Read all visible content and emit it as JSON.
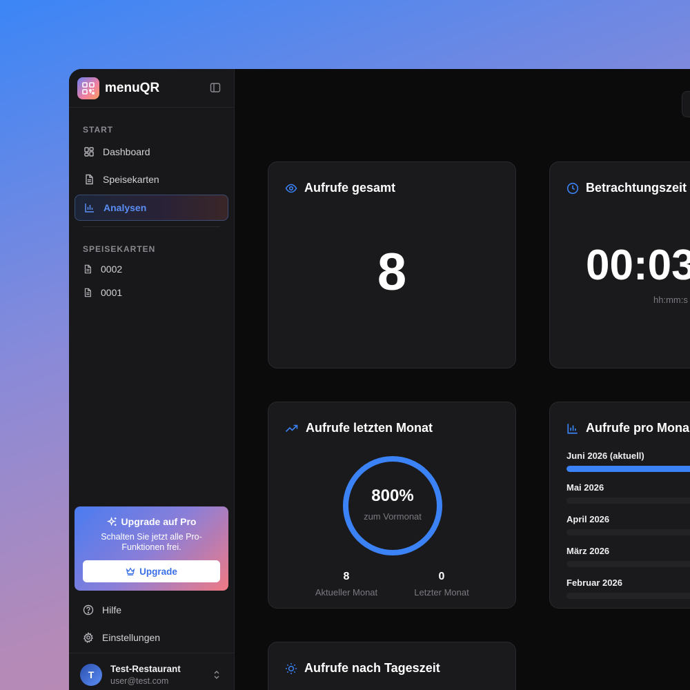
{
  "app": {
    "name": "menuQR"
  },
  "sidebar": {
    "section_start": "START",
    "nav": [
      {
        "label": "Dashboard",
        "icon": "dashboard-icon",
        "active": false
      },
      {
        "label": "Speisekarten",
        "icon": "document-icon",
        "active": false
      },
      {
        "label": "Analysen",
        "icon": "bar-chart-icon",
        "active": true
      }
    ],
    "section_menus": "SPEISEKARTEN",
    "menus": [
      {
        "label": "0002"
      },
      {
        "label": "0001"
      }
    ],
    "upgrade": {
      "title": "Upgrade auf Pro",
      "text": "Schalten Sie jetzt alle Pro-Funktionen frei.",
      "button": "Upgrade"
    },
    "footer_nav": [
      {
        "label": "Hilfe",
        "icon": "help-icon"
      },
      {
        "label": "Einstellungen",
        "icon": "gear-icon"
      }
    ],
    "user": {
      "initial": "T",
      "name": "Test-Restaurant",
      "email": "user@test.com"
    }
  },
  "cards": {
    "total_views": {
      "title": "Aufrufe gesamt",
      "value": "8"
    },
    "view_time": {
      "title": "Betrachtungszeit",
      "value": "00:03",
      "unit": "hh:mm:s"
    },
    "last_month": {
      "title": "Aufrufe letzten Monat",
      "percent": "800%",
      "percent_label": "zum Vormonat",
      "current_value": "8",
      "current_label": "Aktueller Monat",
      "previous_value": "0",
      "previous_label": "Letzter Monat"
    },
    "per_month": {
      "title": "Aufrufe pro Mona",
      "months": [
        {
          "label": "Juni 2026 (aktuell)",
          "fill": 1.0
        },
        {
          "label": "Mai 2026",
          "fill": 0
        },
        {
          "label": "April 2026",
          "fill": 0
        },
        {
          "label": "März 2026",
          "fill": 0
        },
        {
          "label": "Februar 2026",
          "fill": 0
        }
      ]
    },
    "by_time": {
      "title": "Aufrufe nach Tageszeit"
    }
  },
  "colors": {
    "accent": "#3b82f6",
    "card": "#1a1a1c",
    "sidebar": "#18181a"
  }
}
